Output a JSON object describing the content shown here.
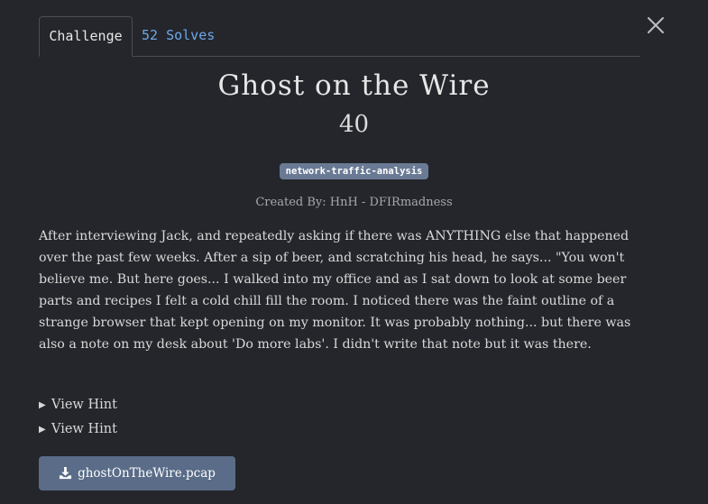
{
  "tabs": {
    "challenge": "Challenge",
    "solves": "52 Solves"
  },
  "challenge": {
    "name": "Ghost on the Wire",
    "points": "40",
    "tag": "network-traffic-analysis",
    "author": "Created By: HnH - DFIRmadness",
    "description": "After interviewing Jack, and repeatedly asking if there was ANYTHING else that happened over the past few weeks. After a sip of beer, and scratching his head, he says... \"You won't believe me. But here goes... I walked into my office and as I sat down to look at some beer parts and recipes I felt a cold chill fill the room. I noticed there was the faint outline of a strange browser that kept opening on my monitor. It was probably nothing... but there was also a note on my desk about 'Do more labs'. I didn't write that note but it was there."
  },
  "hints": [
    {
      "label": "View Hint"
    },
    {
      "label": "View Hint"
    }
  ],
  "download": {
    "filename": "ghostOnTheWire.pcap",
    "icon": "download-icon"
  },
  "icons": {
    "close": "close-icon",
    "hint_caret": "caret-right-icon"
  },
  "colors": {
    "background": "#24262b",
    "tab_link": "#6ea8e8",
    "tag_bg": "#6a7a94",
    "button_bg": "#5a6c88"
  }
}
